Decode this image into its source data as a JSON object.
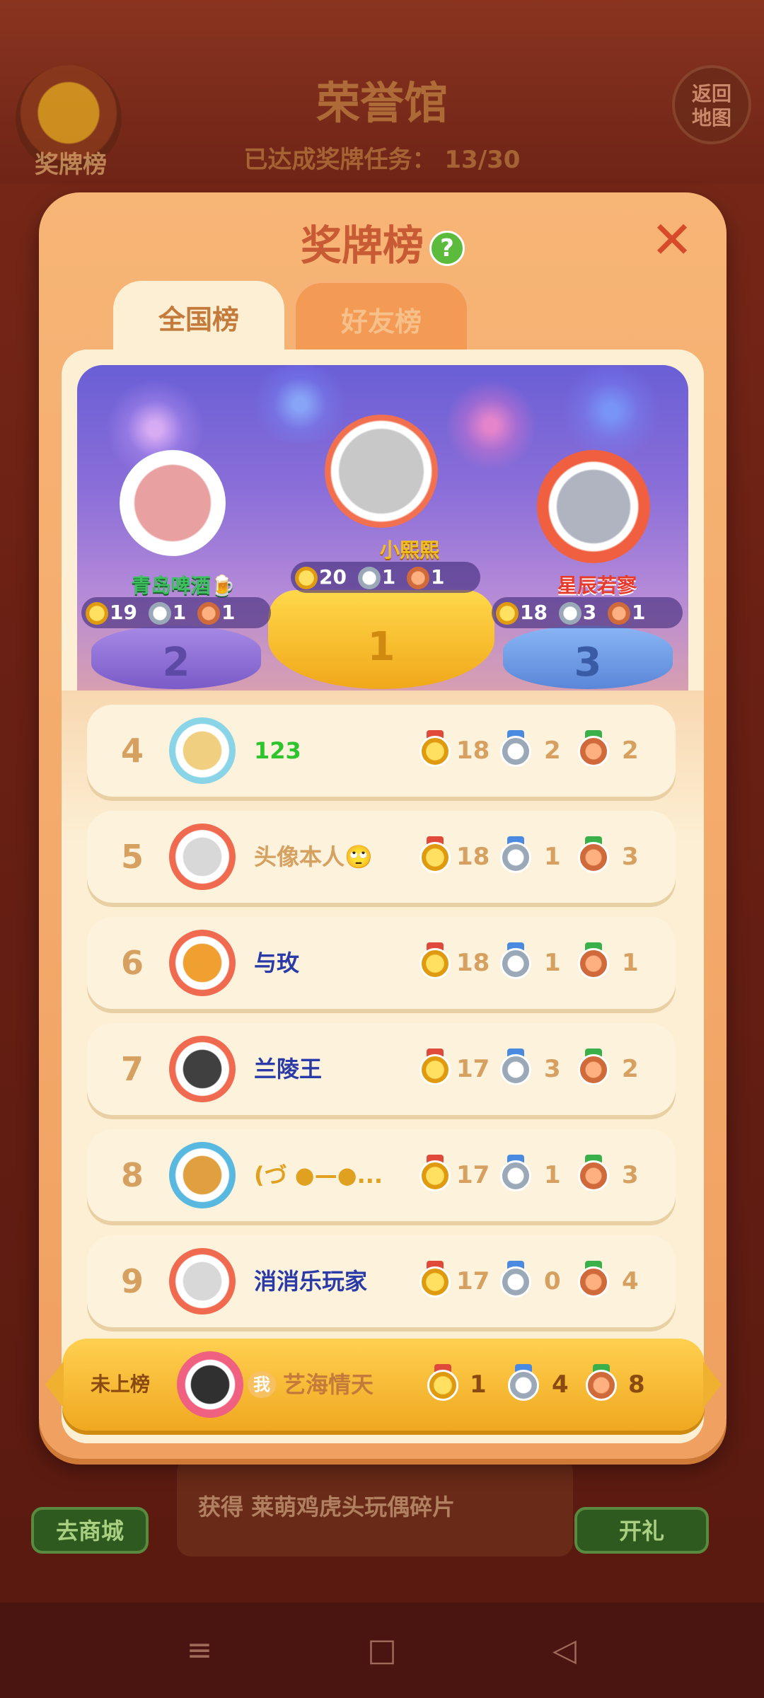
{
  "background": {
    "badge_label": "奖牌榜",
    "title": "荣誉馆",
    "progress_label": "已达成奖牌任务：",
    "progress_value": "13/30",
    "return_label_line1": "返回",
    "return_label_line2": "地图",
    "shop_button": "去商城",
    "gift_button": "开礼",
    "reward_text": "获得 莱萌鸡虎头玩偶碎片"
  },
  "modal": {
    "title": "奖牌榜",
    "help": "?",
    "close": "✕",
    "tabs": [
      {
        "label": "全国榜",
        "active": true
      },
      {
        "label": "好友榜",
        "active": false
      }
    ]
  },
  "podium": {
    "first": {
      "rank": "1",
      "name": "小熙熙",
      "gold": "20",
      "silver": "1",
      "bronze": "1"
    },
    "second": {
      "rank": "2",
      "name": "青岛啤酒🍺",
      "gold": "19",
      "silver": "1",
      "bronze": "1"
    },
    "third": {
      "rank": "3",
      "name": "星辰若寥",
      "gold": "18",
      "silver": "3",
      "bronze": "1"
    }
  },
  "rows": [
    {
      "rank": "4",
      "name": "123",
      "name_color": "#2ec42e",
      "gold": "18",
      "silver": "2",
      "bronze": "2"
    },
    {
      "rank": "5",
      "name": "头像本人🙄",
      "name_color": "#d6a060",
      "gold": "18",
      "silver": "1",
      "bronze": "3"
    },
    {
      "rank": "6",
      "name": "与玫",
      "name_color": "#2a3aa6",
      "gold": "18",
      "silver": "1",
      "bronze": "1"
    },
    {
      "rank": "7",
      "name": "兰陵王",
      "name_color": "#2a3aa6",
      "gold": "17",
      "silver": "3",
      "bronze": "2"
    },
    {
      "rank": "8",
      "name": "(づ ●—●...",
      "name_color": "#e0a020",
      "gold": "17",
      "silver": "1",
      "bronze": "3"
    },
    {
      "rank": "9",
      "name": "消消乐玩家",
      "name_color": "#2a3aa6",
      "gold": "17",
      "silver": "0",
      "bronze": "4"
    }
  ],
  "self": {
    "rank": "未上榜",
    "me_tag": "我",
    "name": "艺海情天",
    "gold": "1",
    "silver": "4",
    "bronze": "8"
  },
  "navbar": {
    "menu": "≡",
    "home": "□",
    "back": "◁"
  },
  "colors": {
    "gold": "#f0b020",
    "silver": "#a8b4c4",
    "bronze": "#e07a40",
    "accent": "#c85a34"
  }
}
